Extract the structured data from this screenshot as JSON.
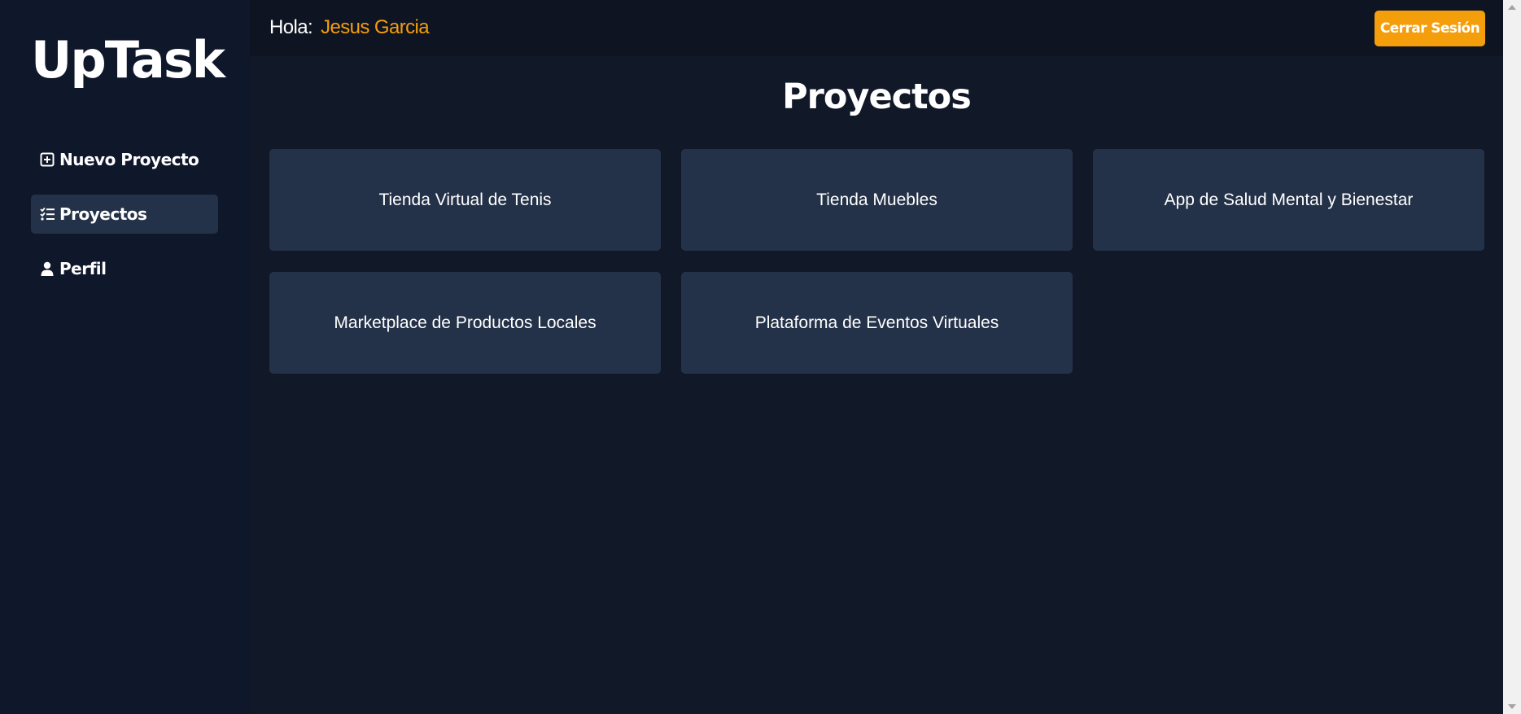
{
  "app": {
    "logo": "UpTask"
  },
  "sidebar": {
    "items": [
      {
        "label": "Nuevo Proyecto",
        "icon": "plus-square-icon",
        "active": false
      },
      {
        "label": "Proyectos",
        "icon": "list-check-icon",
        "active": true
      },
      {
        "label": "Perfil",
        "icon": "user-icon",
        "active": false
      }
    ]
  },
  "header": {
    "greeting": "Hola:",
    "user_name": "Jesus Garcia",
    "logout_label": "Cerrar Sesión"
  },
  "main": {
    "title": "Proyectos",
    "projects": [
      "Tienda Virtual de Tenis",
      "Tienda Muebles",
      "App de Salud Mental y Bienestar",
      "Marketplace de Productos Locales",
      "Plataforma de Eventos Virtuales"
    ]
  },
  "colors": {
    "accent": "#f59e0b",
    "sidebar_bg": "#0f172a",
    "main_bg": "#111827",
    "card_bg": "#243249"
  }
}
